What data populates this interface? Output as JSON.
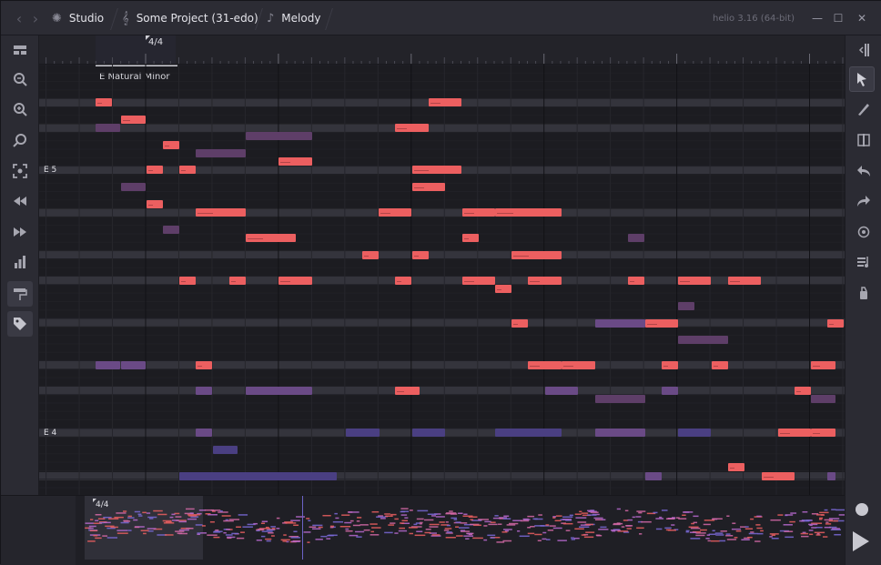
{
  "window": {
    "breadcrumbs": [
      {
        "label": "Studio",
        "icon": "sun-icon"
      },
      {
        "label": "Some Project (31-edo)",
        "icon": "treble-clef-icon"
      },
      {
        "label": "Melody",
        "icon": "music-note-icon"
      }
    ],
    "version": "helio 3.16 (64-bit)",
    "controls": {
      "minimize": "—",
      "maximize": "☐",
      "close": "✕"
    }
  },
  "ruler": {
    "time_signature": "4/4"
  },
  "roll": {
    "scale_label": "E Natural Minor",
    "key_labels": {
      "e5": "E 5",
      "e4": "E 4"
    }
  },
  "minimap": {
    "time_signature": "4/4"
  },
  "left_tools": [
    "piano-roll-icon",
    "zoom-out-icon",
    "zoom-in-icon",
    "zoom-tool-icon",
    "zoom-fit-icon",
    "rewind-icon",
    "fast-forward-icon",
    "velocity-icon",
    "paint-roller-icon",
    "tag-icon"
  ],
  "right_tools": [
    "toggle-sidebar-icon",
    "cursor-icon",
    "pen-icon",
    "cut-icon",
    "undo-icon",
    "redo-icon",
    "settings-gear-icon",
    "arpeggio-icon",
    "chord-icon"
  ],
  "colors": {
    "note_red": "#ec5f60",
    "note_purple": "#5e3e68",
    "note_blue": "#4a3f82",
    "playhead": "#6c63c7"
  }
}
